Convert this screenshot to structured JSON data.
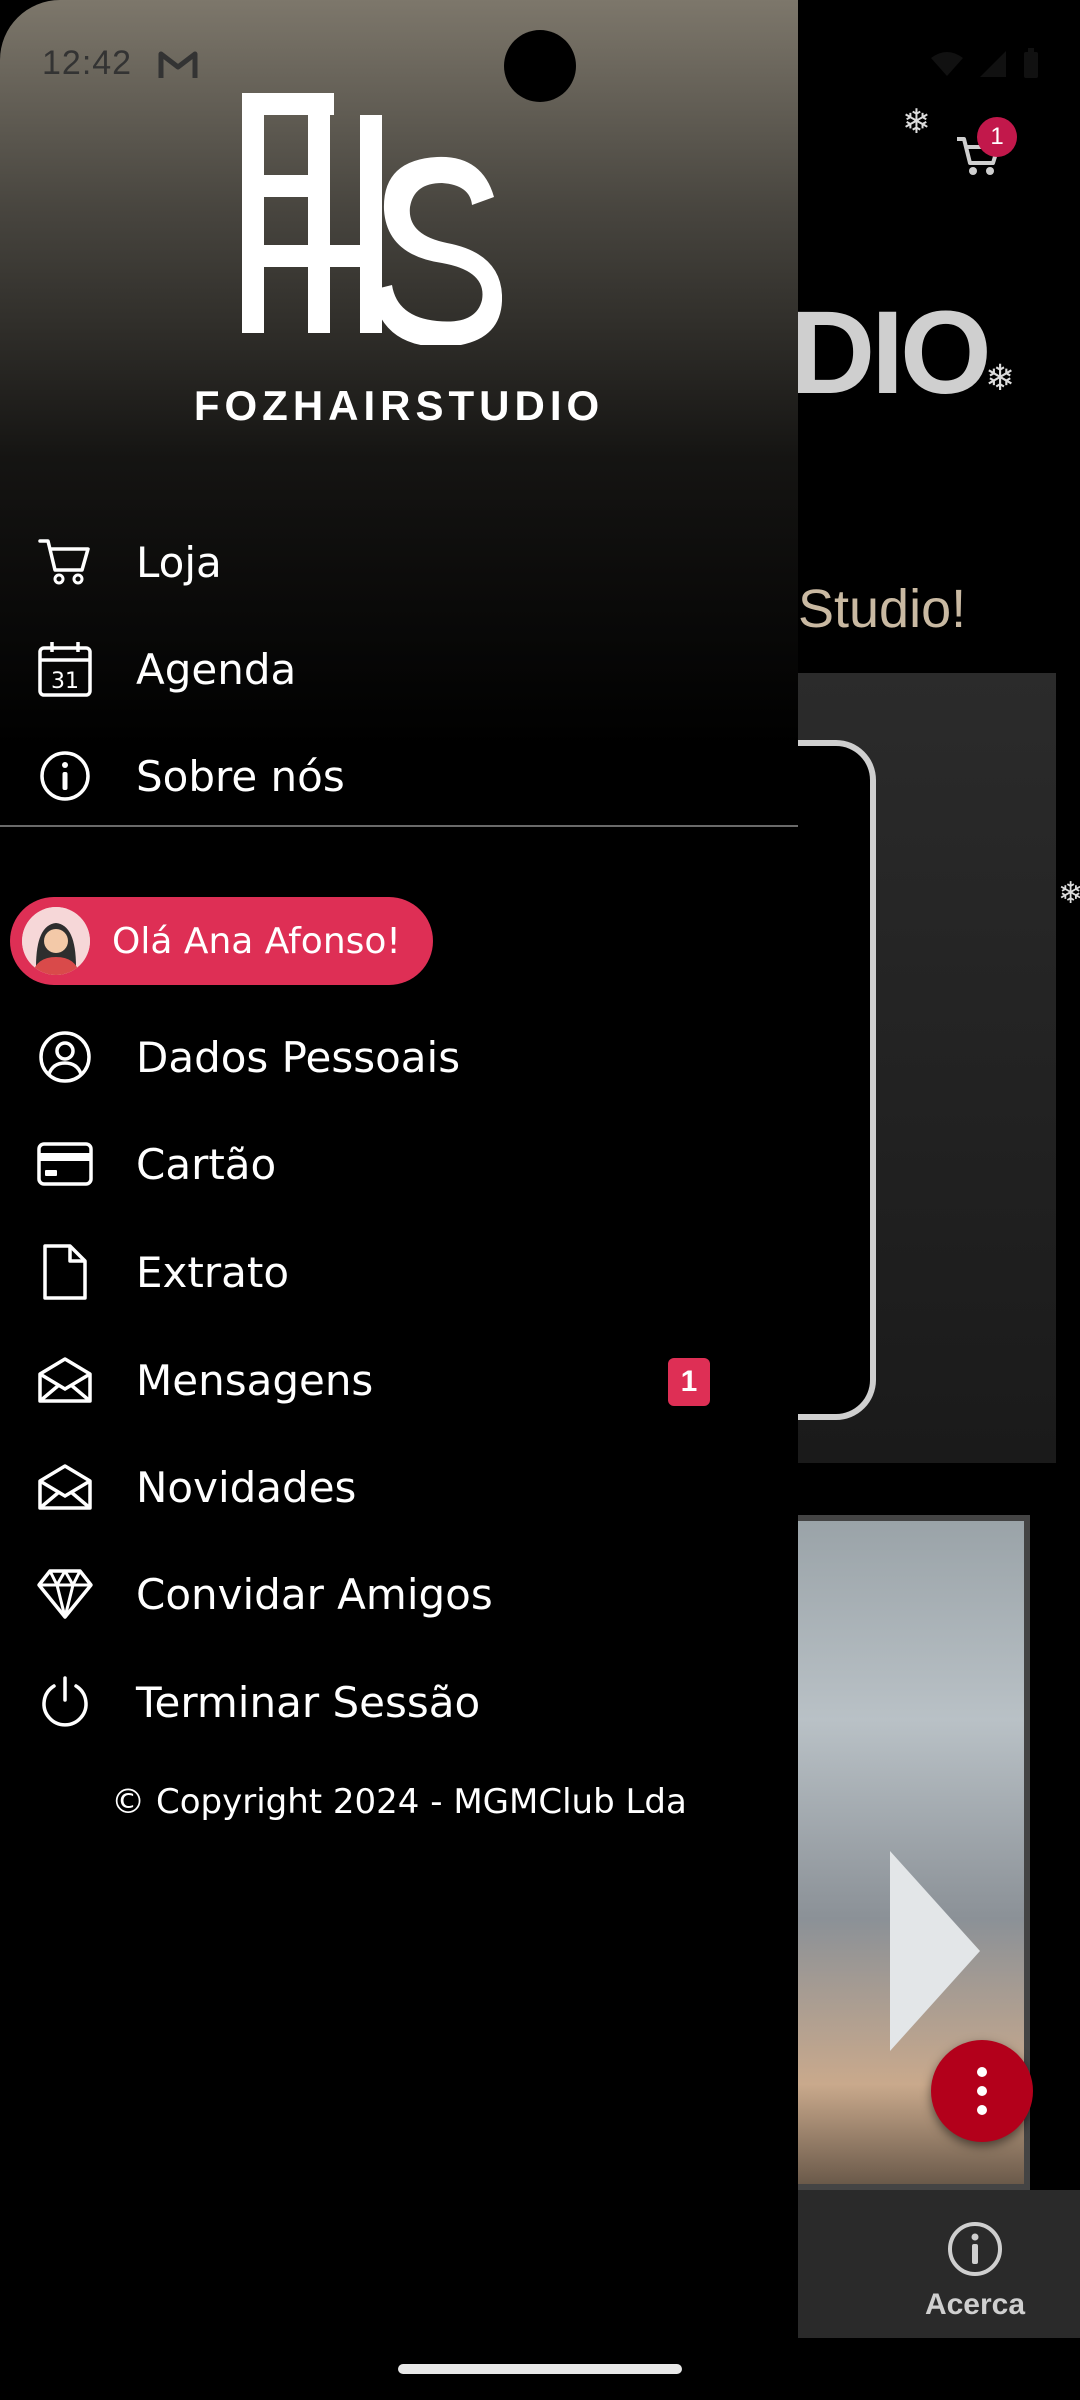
{
  "status_bar": {
    "time": "12:42",
    "mail_icon": "gmail-icon"
  },
  "brand": {
    "logo_text": "FOZHAIRSTUDIO",
    "logo_monogram": "FHS"
  },
  "menu_top": [
    {
      "label": "Loja",
      "icon": "cart-icon"
    },
    {
      "label": "Agenda",
      "icon": "calendar-icon"
    },
    {
      "label": "Sobre nós",
      "icon": "info-icon"
    }
  ],
  "greeting": {
    "label": "Olá Ana Afonso!"
  },
  "menu_account": [
    {
      "label": "Dados Pessoais",
      "icon": "user-circle-icon"
    },
    {
      "label": "Cartão",
      "icon": "card-icon"
    },
    {
      "label": "Extrato",
      "icon": "document-icon"
    },
    {
      "label": "Mensagens",
      "icon": "envelope-open-icon",
      "badge": "1"
    },
    {
      "label": "Novidades",
      "icon": "envelope-open-icon"
    },
    {
      "label": "Convidar Amigos",
      "icon": "diamond-icon"
    },
    {
      "label": "Terminar Sessão",
      "icon": "power-icon"
    }
  ],
  "copyright": "© Copyright 2024 - MGMClub Lda",
  "background_app": {
    "cart_badge": "1",
    "logo_fragment": "DIO",
    "welcome_fragment": "rStudio!",
    "bottom_nav_label": "Acerca"
  },
  "colors": {
    "accent": "#de2f55",
    "fab": "#b3001b",
    "badge": "#c2184b"
  }
}
